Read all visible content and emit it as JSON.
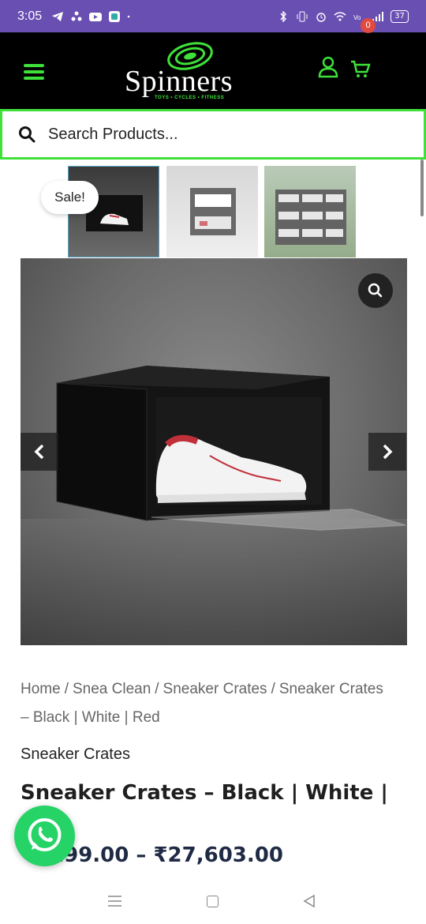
{
  "status_bar": {
    "time": "3:05",
    "battery": "37",
    "left_icons": [
      "telegram-icon",
      "fan-icon",
      "youtube-icon",
      "app-icon",
      "dot-icon"
    ],
    "right_icons": [
      "bluetooth-icon",
      "vibrate-icon",
      "alarm-icon",
      "wifi-icon",
      "volte-icon",
      "signal-icon"
    ]
  },
  "header": {
    "logo_text": "Spinners",
    "logo_tagline": "TOYS • CYCLES • FITNESS",
    "cart_count": "0",
    "accent_color": "#3fe03a"
  },
  "search": {
    "placeholder": "Search Products..."
  },
  "gallery": {
    "sale_badge": "Sale!",
    "thumbnails": [
      "Sneaker crate dark",
      "Sneaker crate light",
      "Sneaker crates stacked"
    ]
  },
  "breadcrumb": {
    "items": [
      "Home",
      "Snea Clean",
      "Sneaker Crates",
      "Sneaker Crates – Black | White | Red"
    ],
    "separator": "/"
  },
  "product": {
    "category": "Sneaker Crates",
    "title": "Sneaker Crates – Black | White | Red",
    "price": "₹…,299.00 – ₹27,603.00",
    "price_visible": "₹ ,299.00 – ₹27,603.00"
  }
}
